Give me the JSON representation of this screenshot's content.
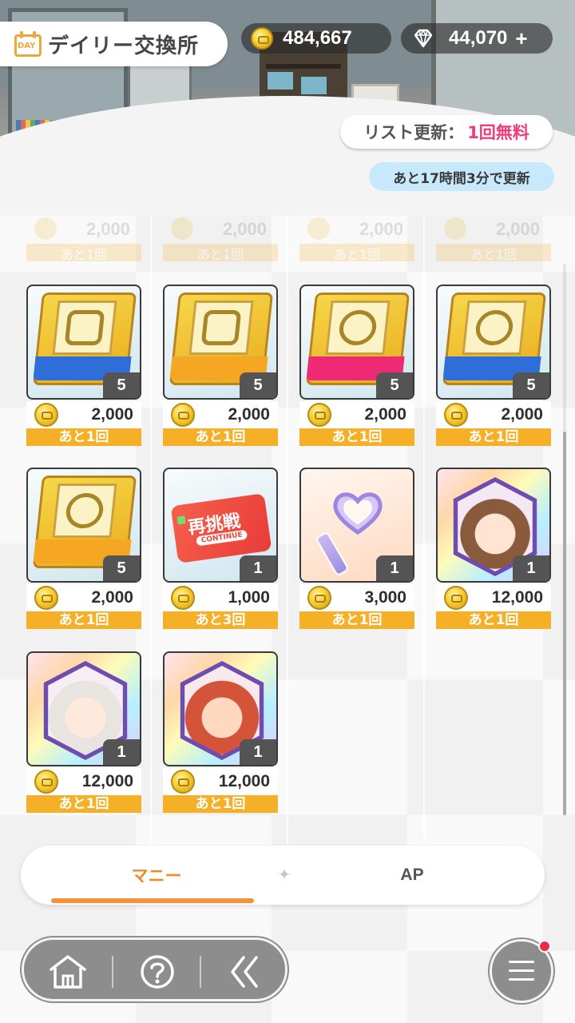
{
  "header": {
    "title": "デイリー交換所",
    "calendar_label": "DAY",
    "money": "484,667",
    "gems": "44,070",
    "gems_add": "+",
    "refresh_label": "リスト更新：",
    "refresh_free": "1回無料",
    "timer": "あと17時間3分で更新"
  },
  "faded_row": [
    {
      "price": "2,000",
      "limit": "あと1回"
    },
    {
      "price": "2,000",
      "limit": "あと1回"
    },
    {
      "price": "2,000",
      "limit": "あと1回"
    },
    {
      "price": "2,000",
      "limit": "あと1回"
    }
  ],
  "items": [
    {
      "name": "book-blue-square",
      "qty": "5",
      "price": "2,000",
      "limit": "あと1回"
    },
    {
      "name": "book-orange-square",
      "qty": "5",
      "price": "2,000",
      "limit": "あと1回"
    },
    {
      "name": "book-pink-round",
      "qty": "5",
      "price": "2,000",
      "limit": "あと1回"
    },
    {
      "name": "book-blue-round",
      "qty": "5",
      "price": "2,000",
      "limit": "あと1回"
    },
    {
      "name": "book-orange-round",
      "qty": "5",
      "price": "2,000",
      "limit": "あと1回"
    },
    {
      "name": "retry-ticket",
      "qty": "1",
      "price": "1,000",
      "limit": "あと3回",
      "ticket_text": "再挑戦",
      "ticket_sub": "CONTINUE"
    },
    {
      "name": "heart-key",
      "qty": "1",
      "price": "3,000",
      "limit": "あと1回"
    },
    {
      "name": "idol-portrait-1",
      "qty": "1",
      "price": "12,000",
      "limit": "あと1回"
    },
    {
      "name": "idol-portrait-2",
      "qty": "1",
      "price": "12,000",
      "limit": "あと1回"
    },
    {
      "name": "idol-portrait-3",
      "qty": "1",
      "price": "12,000",
      "limit": "あと1回"
    }
  ],
  "tabs": {
    "money": "マニー",
    "ap": "AP",
    "separator": "✦"
  },
  "icons": {
    "home": "home-icon",
    "help": "help-icon",
    "back": "back-icon",
    "menu": "menu-icon"
  },
  "colors": {
    "accent": "#f5923b",
    "limit_bar": "#f6b027",
    "free_text": "#ee3b79",
    "timer_bg": "#c8e9fb"
  }
}
